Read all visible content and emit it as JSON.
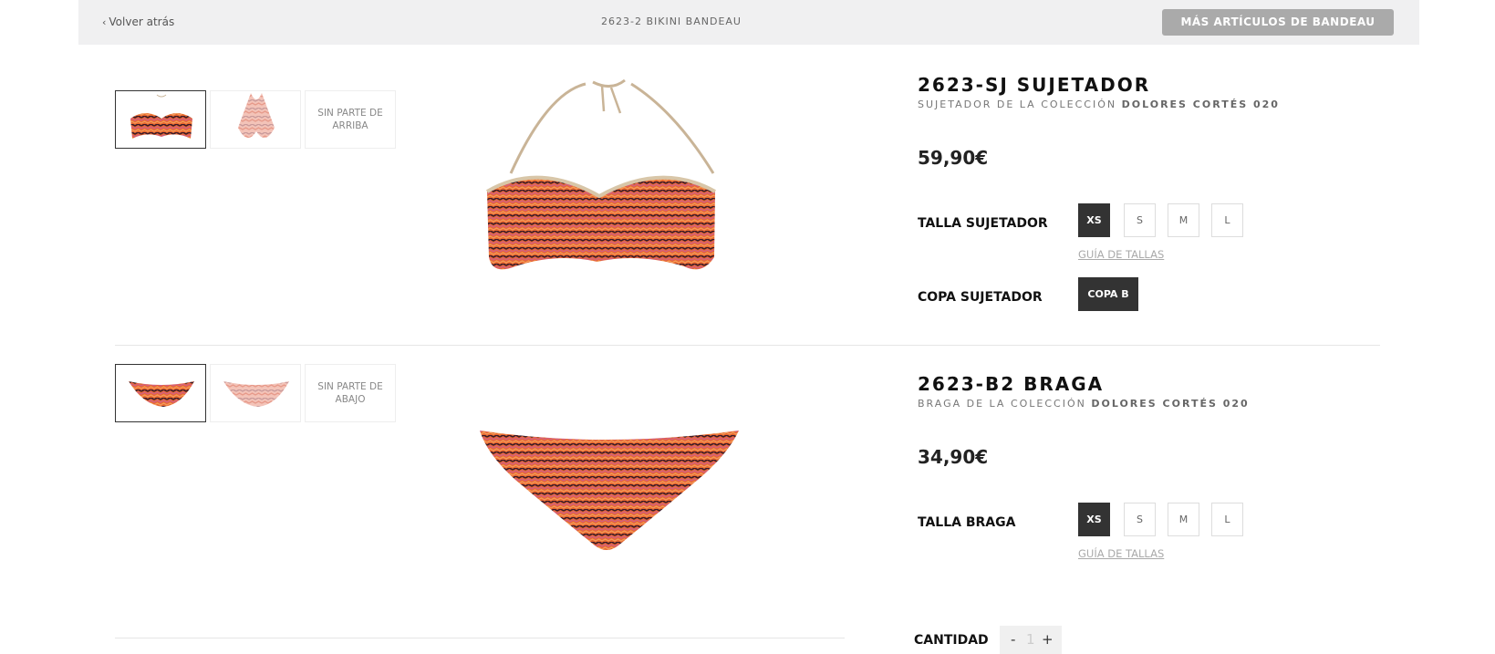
{
  "header": {
    "back_label": "Volver atrás",
    "product_code": "2623-2 BIKINI BANDEAU",
    "more_button": "MÁS ARTÍCULOS DE BANDEAU"
  },
  "top": {
    "title": "2623-SJ SUJETADOR",
    "subtitle_prefix": "SUJETADOR DE LA COLECCIÓN",
    "collection": "DOLORES CORTÉS 020",
    "price": "59,90€",
    "size_label": "TALLA SUJETADOR",
    "sizes": [
      "XS",
      "S",
      "M",
      "L"
    ],
    "selected_size": "XS",
    "guide": "GUÍA DE TALLAS",
    "cup_label": "COPA SUJETADOR",
    "cup_value": "COPA B",
    "no_part": "SIN PARTE DE ARRIBA"
  },
  "bottom": {
    "title": "2623-B2 BRAGA",
    "subtitle_prefix": "BRAGA DE LA COLECCIÓN",
    "collection": "DOLORES CORTÉS 020",
    "price": "34,90€",
    "size_label": "TALLA BRAGA",
    "sizes": [
      "XS",
      "S",
      "M",
      "L"
    ],
    "selected_size": "XS",
    "guide": "GUÍA DE TALLAS",
    "no_part": "SIN PARTE DE ABAJO"
  },
  "quantity": {
    "label": "CANTIDAD",
    "minus": "-",
    "value": "1",
    "plus": "+"
  },
  "colors": {
    "stripe_orange": "#e8682e",
    "stripe_pink": "#d4607a",
    "stripe_dark": "#3a1a2a",
    "strap_beige": "#c9b497"
  }
}
